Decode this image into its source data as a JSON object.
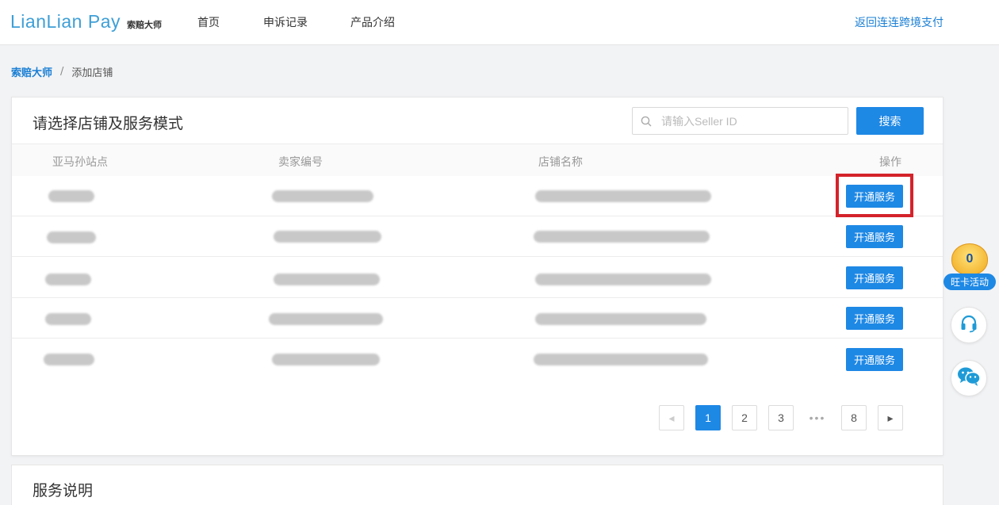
{
  "header": {
    "logo_text": "LianLian Pay",
    "logo_sub": "索赔大师",
    "nav": [
      "首页",
      "申诉记录",
      "产品介绍"
    ],
    "return_link": "返回连连跨境支付"
  },
  "breadcrumb": {
    "root": "索赔大师",
    "separator": "/",
    "current": "添加店铺"
  },
  "panel": {
    "title": "请选择店铺及服务模式",
    "search": {
      "placeholder": "请输入Seller ID",
      "value": "",
      "button_label": "搜索"
    },
    "table": {
      "headers": [
        "亚马孙站点",
        "卖家编号",
        "店铺名称",
        "操作"
      ],
      "rows": [
        {
          "action_label": "开通服务",
          "highlighted": true
        },
        {
          "action_label": "开通服务",
          "highlighted": false
        },
        {
          "action_label": "开通服务",
          "highlighted": false
        },
        {
          "action_label": "开通服务",
          "highlighted": false
        },
        {
          "action_label": "开通服务",
          "highlighted": false
        }
      ]
    },
    "pagination": {
      "prev": "◂",
      "pages": [
        "1",
        "2",
        "3"
      ],
      "ellipsis": "•••",
      "last": "8",
      "next": "▸",
      "current": "1"
    }
  },
  "service_section": {
    "title": "服务说明"
  },
  "floating": {
    "promo_badge": "0",
    "promo_label": "旺卡活动",
    "support_icon": "headset-icon",
    "wechat_icon": "wechat-icon"
  },
  "colors": {
    "accent": "#1e88e5",
    "highlight": "#d4232b",
    "link": "#1a7fd4"
  }
}
